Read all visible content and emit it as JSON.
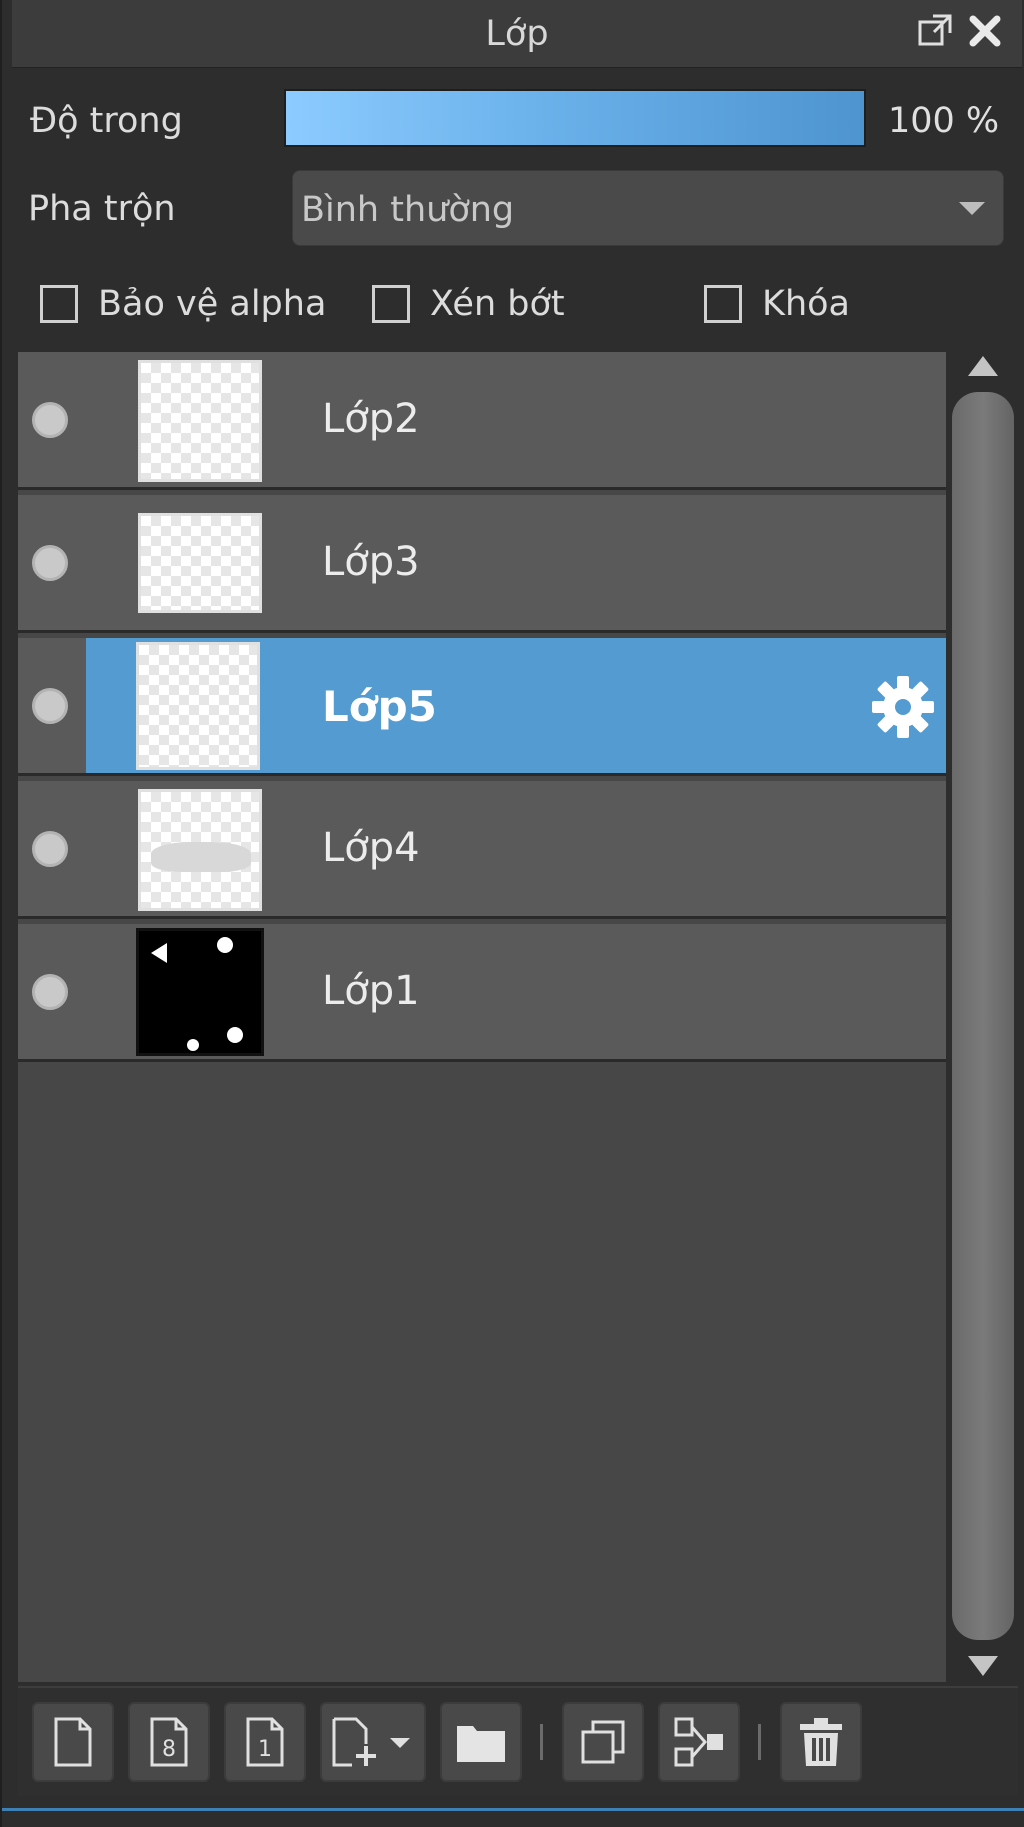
{
  "panel": {
    "title": "Lớp"
  },
  "opacity": {
    "label": "Độ trong",
    "value": "100 %",
    "level": 1.0
  },
  "blend": {
    "label": "Pha trộn",
    "selected": "Bình thường"
  },
  "options": {
    "alpha_protect": "Bảo vệ alpha",
    "clipping": "Xén bớt",
    "lock": "Khóa"
  },
  "layers": [
    {
      "name": "Lớp2",
      "selected": false
    },
    {
      "name": "Lớp3",
      "selected": false
    },
    {
      "name": "Lớp5",
      "selected": true
    },
    {
      "name": "Lớp4",
      "selected": false
    },
    {
      "name": "Lớp1",
      "selected": false
    }
  ],
  "toolbar": {
    "page8": "8",
    "page1": "1"
  },
  "colors": {
    "accent": "#539bd0",
    "layer_bg": "#5a5a5a",
    "panel_bg": "#2d2d2d"
  }
}
